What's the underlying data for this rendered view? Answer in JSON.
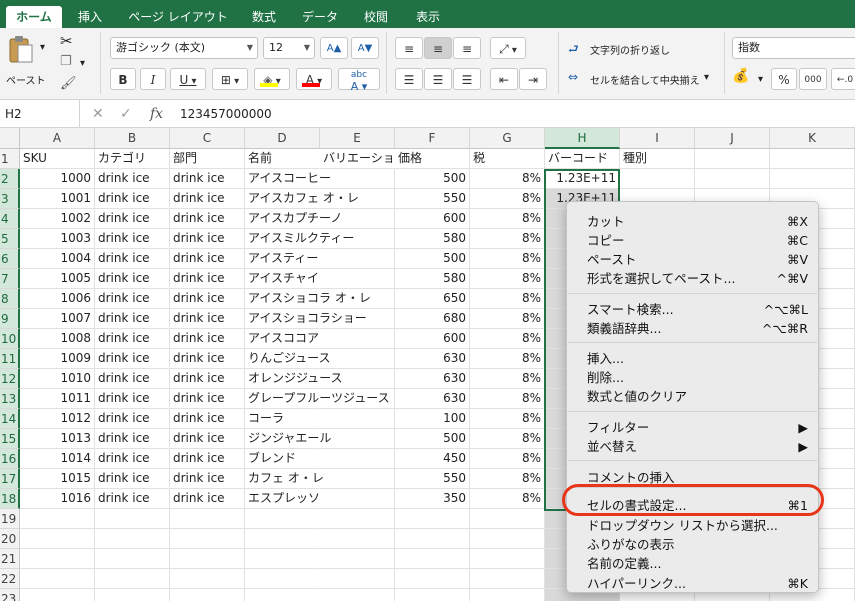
{
  "ribbon_tabs": [
    "ホーム",
    "挿入",
    "ページ レイアウト",
    "数式",
    "データ",
    "校閲",
    "表示"
  ],
  "ribbon": {
    "paste_label": "ペースト",
    "font_name": "游ゴシック (本文)",
    "font_size": "12",
    "grow_font": "A▲",
    "shrink_font": "A▼",
    "bold": "B",
    "italic": "I",
    "underline": "U",
    "font_color_letter": "A",
    "fill_color": "#ffff00",
    "font_color": "#ff0000",
    "phonetic_label": "abc",
    "wrap_text": "文字列の折り返し",
    "merge_center": "セルを結合して中央揃え",
    "number_format": "指数",
    "percent": "%",
    "comma": "000"
  },
  "formula_bar": {
    "name_box": "H2",
    "fx": "fx",
    "value": "123457000000"
  },
  "grid": {
    "columns": [
      "A",
      "B",
      "C",
      "D",
      "E",
      "F",
      "G",
      "H",
      "I",
      "J",
      "K"
    ],
    "selected_column": "H",
    "header_row": [
      "SKU",
      "カテゴリ",
      "部門",
      "名前",
      "バリエーショ",
      "価格",
      "税",
      "バーコード",
      "種別",
      "",
      ""
    ],
    "rows": [
      [
        "1000",
        "drink ice",
        "drink ice",
        "アイスコーヒー",
        "",
        "500",
        "8%",
        "1.23E+11"
      ],
      [
        "1001",
        "drink ice",
        "drink ice",
        "アイスカフェ オ・レ",
        "",
        "550",
        "8%",
        "1.23E+11"
      ],
      [
        "1002",
        "drink ice",
        "drink ice",
        "アイスカプチーノ",
        "",
        "600",
        "8%",
        ""
      ],
      [
        "1003",
        "drink ice",
        "drink ice",
        "アイスミルクティー",
        "",
        "580",
        "8%",
        ""
      ],
      [
        "1004",
        "drink ice",
        "drink ice",
        "アイスティー",
        "",
        "500",
        "8%",
        ""
      ],
      [
        "1005",
        "drink ice",
        "drink ice",
        "アイスチャイ",
        "",
        "580",
        "8%",
        ""
      ],
      [
        "1006",
        "drink ice",
        "drink ice",
        "アイスショコラ オ・レ",
        "",
        "650",
        "8%",
        ""
      ],
      [
        "1007",
        "drink ice",
        "drink ice",
        "アイスショコラショー",
        "",
        "680",
        "8%",
        ""
      ],
      [
        "1008",
        "drink ice",
        "drink ice",
        "アイスココア",
        "",
        "600",
        "8%",
        ""
      ],
      [
        "1009",
        "drink ice",
        "drink ice",
        "りんごジュース",
        "",
        "630",
        "8%",
        ""
      ],
      [
        "1010",
        "drink ice",
        "drink ice",
        "オレンジジュース",
        "",
        "630",
        "8%",
        ""
      ],
      [
        "1011",
        "drink ice",
        "drink ice",
        "グレープフルーツジュース",
        "",
        "630",
        "8%",
        ""
      ],
      [
        "1012",
        "drink ice",
        "drink ice",
        "コーラ",
        "",
        "100",
        "8%",
        ""
      ],
      [
        "1013",
        "drink ice",
        "drink ice",
        "ジンジャエール",
        "",
        "500",
        "8%",
        ""
      ],
      [
        "1014",
        "drink ice",
        "drink ice",
        "ブレンド",
        "",
        "450",
        "8%",
        ""
      ],
      [
        "1015",
        "drink ice",
        "drink ice",
        "カフェ オ・レ",
        "",
        "550",
        "8%",
        ""
      ],
      [
        "1016",
        "drink ice",
        "drink ice",
        "エスプレッソ",
        "",
        "350",
        "8%",
        ""
      ]
    ],
    "row_numbers": [
      "1",
      "2",
      "3",
      "4",
      "5",
      "6",
      "7",
      "8",
      "9",
      "10",
      "11",
      "12",
      "13",
      "14",
      "15",
      "16",
      "17",
      "18",
      "19",
      "20",
      "21",
      "22",
      "23"
    ]
  },
  "context_menu": {
    "groups": [
      [
        {
          "label": "カット",
          "shortcut": "⌘X"
        },
        {
          "label": "コピー",
          "shortcut": "⌘C"
        },
        {
          "label": "ペースト",
          "shortcut": "⌘V"
        },
        {
          "label": "形式を選択してペースト...",
          "shortcut": "^⌘V"
        }
      ],
      [
        {
          "label": "スマート検索...",
          "shortcut": "^⌥⌘L"
        },
        {
          "label": "類義語辞典...",
          "shortcut": "^⌥⌘R"
        }
      ],
      [
        {
          "label": "挿入...",
          "shortcut": ""
        },
        {
          "label": "削除...",
          "shortcut": ""
        },
        {
          "label": "数式と値のクリア",
          "shortcut": ""
        }
      ],
      [
        {
          "label": "フィルター",
          "shortcut": "▶"
        },
        {
          "label": "並べ替え",
          "shortcut": "▶"
        }
      ],
      [
        {
          "label": "コメントの挿入",
          "shortcut": ""
        }
      ],
      [
        {
          "label": "セルの書式設定...",
          "shortcut": "⌘1"
        },
        {
          "label": "ドロップダウン リストから選択...",
          "shortcut": ""
        },
        {
          "label": "ふりがなの表示",
          "shortcut": ""
        },
        {
          "label": "名前の定義...",
          "shortcut": ""
        },
        {
          "label": "ハイパーリンク...",
          "shortcut": "⌘K"
        }
      ]
    ],
    "highlighted_item": "セルの書式設定...",
    "highlight_color": "#e8361a"
  },
  "colors": {
    "excel_green": "#207245",
    "selection_border": "#217346"
  }
}
